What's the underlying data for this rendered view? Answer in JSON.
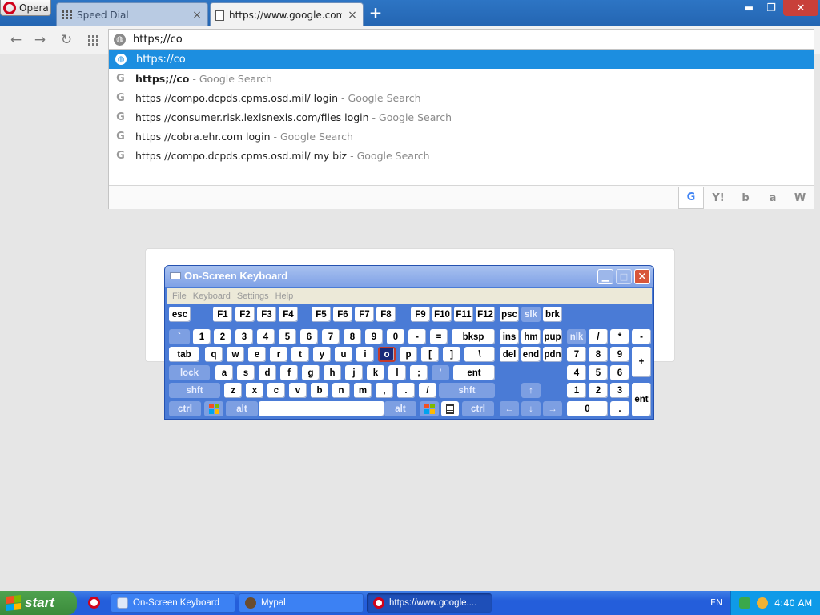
{
  "browser": {
    "menu_label": "Opera",
    "tabs": [
      {
        "label": "Speed Dial",
        "close": "×"
      },
      {
        "label": "https://www.google.com",
        "close": "×"
      }
    ],
    "new_tab": "+",
    "window_controls": {
      "minimize": "▬",
      "maximize": "❐",
      "close": "✕"
    },
    "nav": {
      "back": "←",
      "forward": "→",
      "reload": "↻"
    },
    "address": {
      "value": "https;//co",
      "icon": "globe-icon"
    }
  },
  "suggestions": [
    {
      "text": "https://co",
      "suffix": "",
      "icon": "globe-icon",
      "selected": true
    },
    {
      "text": "https;//co",
      "suffix": " - Google Search",
      "icon": "google-icon"
    },
    {
      "text": "https //compo.dcpds.cpms.osd.mil/ login",
      "suffix": " - Google Search",
      "icon": "google-icon"
    },
    {
      "text": "https //consumer.risk.lexisnexis.com/files login",
      "suffix": " - Google Search",
      "icon": "google-icon"
    },
    {
      "text": "https //cobra.ehr.com login",
      "suffix": " - Google Search",
      "icon": "google-icon"
    },
    {
      "text": "https //compo.dcpds.cpms.osd.mil/ my biz",
      "suffix": " - Google Search",
      "icon": "google-icon"
    }
  ],
  "search_engines": [
    {
      "name": "google",
      "glyph": "G"
    },
    {
      "name": "yahoo",
      "glyph": "Y!"
    },
    {
      "name": "bing",
      "glyph": "b"
    },
    {
      "name": "amazon",
      "glyph": "a"
    },
    {
      "name": "wikipedia",
      "glyph": "W"
    }
  ],
  "osk": {
    "title": "On-Screen Keyboard",
    "menu": [
      "File",
      "Keyboard",
      "Settings",
      "Help"
    ],
    "keys": {
      "esc": "esc",
      "f1": "F1",
      "f2": "F2",
      "f3": "F3",
      "f4": "F4",
      "f5": "F5",
      "f6": "F6",
      "f7": "F7",
      "f8": "F8",
      "f9": "F9",
      "f10": "F10",
      "f11": "F11",
      "f12": "F12",
      "psc": "psc",
      "slk": "slk",
      "brk": "brk",
      "backtick": "`",
      "n1": "1",
      "n2": "2",
      "n3": "3",
      "n4": "4",
      "n5": "5",
      "n6": "6",
      "n7": "7",
      "n8": "8",
      "n9": "9",
      "n0": "0",
      "minus": "-",
      "equals": "=",
      "bksp": "bksp",
      "ins": "ins",
      "hm": "hm",
      "pup": "pup",
      "nlk": "nlk",
      "kp_div": "/",
      "kp_mul": "*",
      "kp_sub": "-",
      "tab": "tab",
      "q": "q",
      "w": "w",
      "e": "e",
      "r": "r",
      "t": "t",
      "y": "y",
      "u": "u",
      "i": "i",
      "o": "o",
      "p": "p",
      "lbracket": "[",
      "rbracket": "]",
      "backslash": "\\",
      "del": "del",
      "end": "end",
      "pdn": "pdn",
      "kp7": "7",
      "kp8": "8",
      "kp9": "9",
      "kp_add": "+",
      "lock": "lock",
      "a": "a",
      "s": "s",
      "d": "d",
      "f": "f",
      "g": "g",
      "h": "h",
      "j": "j",
      "k": "k",
      "l": "l",
      "semicolon": ";",
      "quote": "'",
      "ent": "ent",
      "kp4": "4",
      "kp5": "5",
      "kp6": "6",
      "lshft": "shft",
      "z": "z",
      "x": "x",
      "c": "c",
      "v": "v",
      "b": "b",
      "n": "n",
      "m": "m",
      "comma": ",",
      "period": ".",
      "slash": "/",
      "rshft": "shft",
      "up": "↑",
      "kp1": "1",
      "kp2": "2",
      "kp3": "3",
      "kp_ent": "ent",
      "lctrl": "ctrl",
      "lalt": "alt",
      "ralt": "alt",
      "rctrl": "ctrl",
      "left": "←",
      "down": "↓",
      "right": "→",
      "kp0": "0",
      "kp_dot": "."
    },
    "pressed_key": "o"
  },
  "taskbar": {
    "start": "start",
    "tasks": [
      {
        "label": "On-Screen Keyboard",
        "icon": "keyboard-icon"
      },
      {
        "label": "Mypal",
        "icon": "mypal-icon"
      },
      {
        "label": "https://www.google....",
        "icon": "opera-icon",
        "active": true
      }
    ],
    "language": "EN",
    "clock": "4:40 AM"
  }
}
